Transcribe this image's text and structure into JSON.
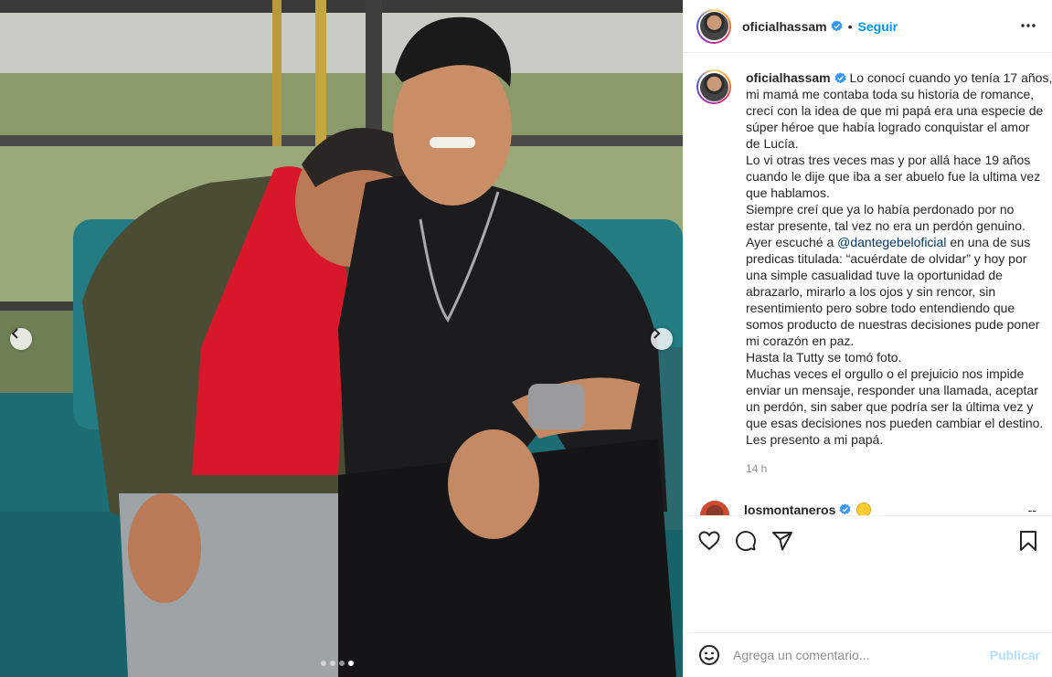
{
  "post": {
    "username": "oficialhassam",
    "follow_label": "Seguir",
    "separator": "•",
    "caption_lines": [
      "Lo conocí cuando yo tenía 17 años,",
      "mi mamá me contaba toda su historia de romance,",
      "crecí con la idea de que mi papá era una especie de",
      "súper héroe que había logrado conquistar el amor",
      "de Lucía.",
      "Lo vi otras tres veces mas y por allá hace 19 años",
      "cuando le dije que iba a ser abuelo fue la ultima vez",
      "que hablamos.",
      "Siempre creí que ya lo había perdonado por no",
      "estar presente, tal vez no era un perdón genuino.",
      "Ayer escuché a",
      "predicas titulada: “acuérdate de olvidar” y hoy por",
      "una simple casualidad tuve la oportunidad de",
      "abrazarlo, mirarlo a los ojos y sin rencor, sin",
      "resentimiento pero sobre todo entendiendo que",
      "somos producto de nuestras decisiones pude poner",
      "mi corazón en paz.",
      "Hasta la Tutty se tomó foto.",
      "Muchas veces el orgullo o el prejuicio nos impide",
      "enviar un mensaje, responder una llamada, aceptar",
      "un perdón, sin saber que podría ser la última vez y",
      "que esas decisiones nos pueden cambiar el destino.",
      "Les presento a mi papá."
    ],
    "caption_first_line": "Lo conocí cuando yo tenía 17 años,",
    "mention": "@dantegebeloficial",
    "mention_suffix": " en una de sus",
    "timestamp": "14 h"
  },
  "comments_peek": {
    "username": "losmontaneros",
    "trailing": "--"
  },
  "comment_box": {
    "placeholder": "Agrega un comentario...",
    "publish_label": "Publicar"
  },
  "carousel": {
    "total": 4,
    "active_index": 3
  },
  "colors": {
    "accent": "#0095f6",
    "verified": "#3897f0",
    "publish_disabled": "#b2dffc",
    "muted": "#8e8e8e"
  },
  "icons": [
    "verified-badge-icon",
    "more-options-icon",
    "heart-icon",
    "comment-icon",
    "share-icon",
    "bookmark-icon",
    "emoji-icon",
    "chevron-left-icon",
    "chevron-right-icon"
  ]
}
